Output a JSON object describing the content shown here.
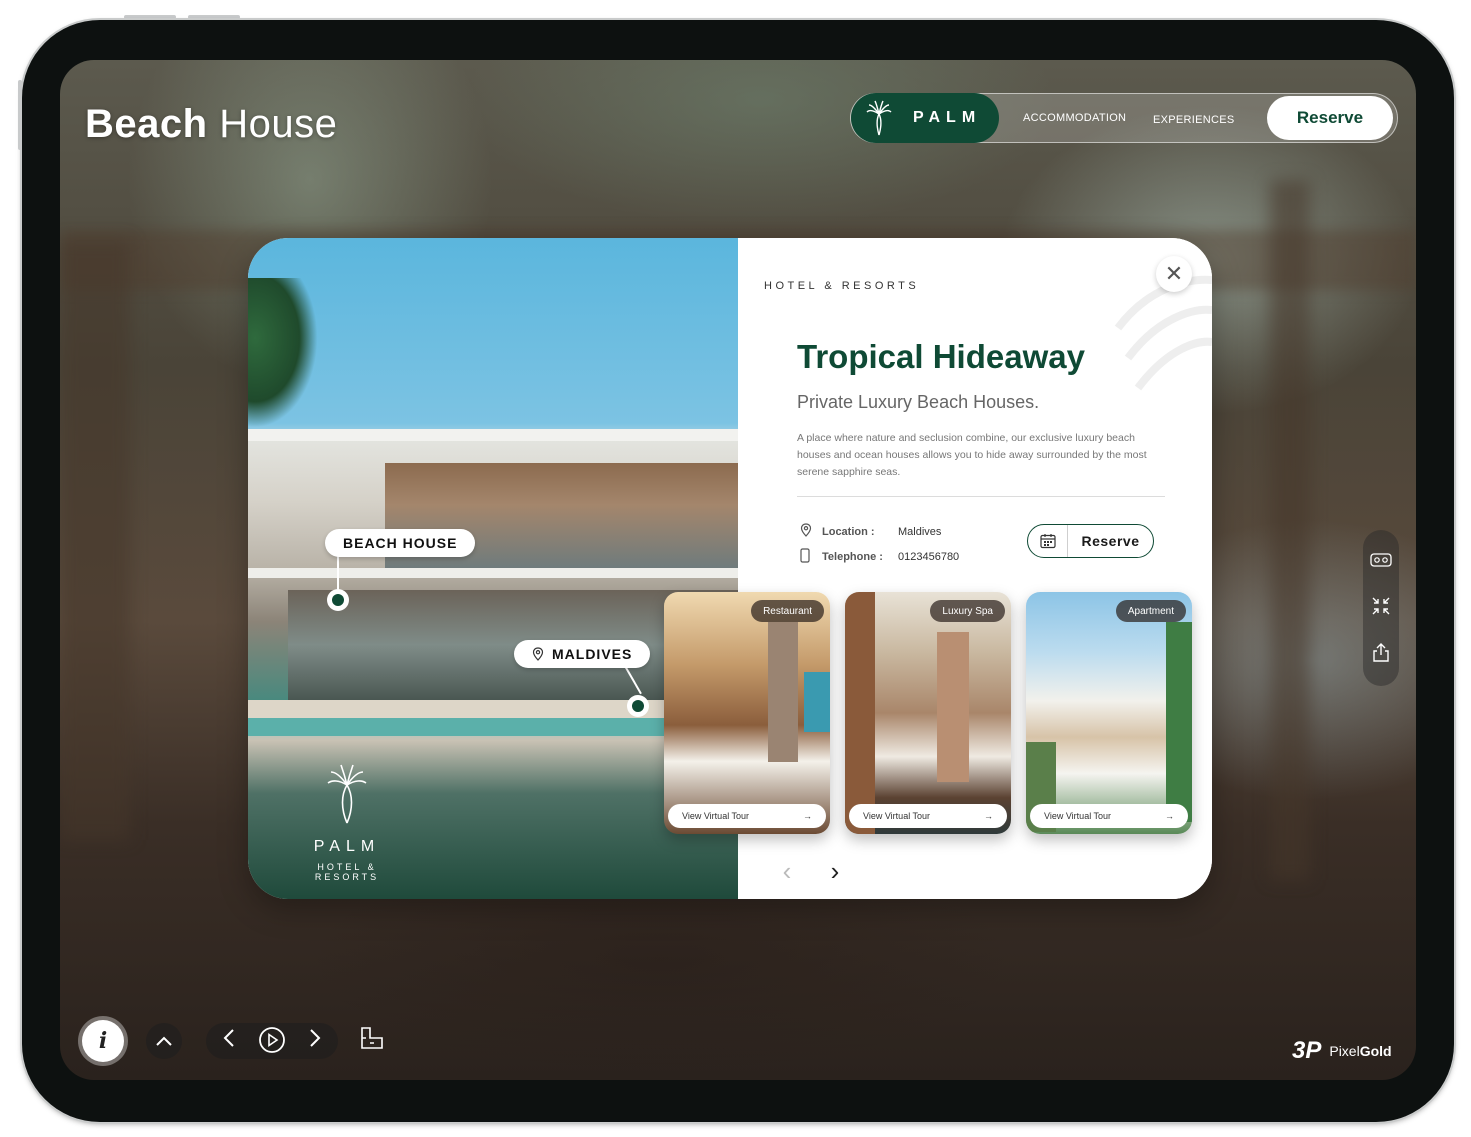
{
  "app": {
    "title_bold": "Beach",
    "title_light": "House"
  },
  "nav": {
    "logo_text": "PALM",
    "items": [
      "ACCOMMODATION",
      "EXPERIENCES"
    ],
    "reserve_label": "Reserve"
  },
  "hero": {
    "pins": {
      "beach_house": "BEACH HOUSE",
      "maldives": "MALDIVES"
    },
    "logo_name": "PALM",
    "logo_sub": "HOTEL & RESORTS"
  },
  "info": {
    "eyebrow": "HOTEL & RESORTS",
    "title": "Tropical Hideaway",
    "subtitle": "Private Luxury Beach Houses.",
    "description": "A place where nature and seclusion combine, our exclusive luxury beach houses and ocean houses allows you to hide away surrounded by the most serene sapphire seas.",
    "location_label": "Location :",
    "location_value": "Maldives",
    "telephone_label": "Telephone :",
    "telephone_value": "0123456780",
    "reserve_label": "Reserve"
  },
  "thumbnails": [
    {
      "tag": "Restaurant",
      "button": "View Virtual Tour"
    },
    {
      "tag": "Luxury Spa",
      "button": "View Virtual Tour"
    },
    {
      "tag": "Apartment",
      "button": "View Virtual Tour"
    }
  ],
  "credit": {
    "logo": "3P",
    "brand_light": "Pixel",
    "brand_bold": "Gold"
  },
  "colors": {
    "brand_green": "#0f4a35",
    "white": "#ffffff"
  },
  "icons": [
    "palm-logo-icon",
    "close-icon",
    "location-icon",
    "phone-icon",
    "calendar-icon",
    "arrow-right-icon",
    "chevron-left-icon",
    "chevron-right-icon",
    "vr-icon",
    "compress-icon",
    "share-icon",
    "info-icon",
    "chevron-up-icon",
    "play-icon",
    "floorplan-icon"
  ]
}
